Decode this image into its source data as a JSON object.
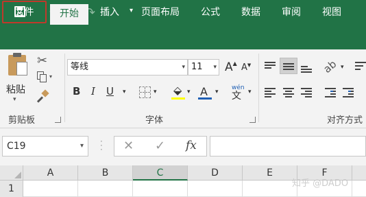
{
  "qat": {
    "customize_glyph": "▾",
    "undo_glyph": "↶",
    "redo_glyph": "↷",
    "dd_glyph": "▾"
  },
  "tabs": {
    "file": "文件",
    "home": "开始",
    "insert": "插入",
    "page_layout": "页面布局",
    "formulas": "公式",
    "data": "数据",
    "review": "审阅",
    "view": "视图"
  },
  "ribbon": {
    "paste_label": "粘贴",
    "clipboard_group": "剪贴板",
    "font_group": "字体",
    "alignment_group": "对齐方式",
    "font_name": "等线",
    "font_size": "11",
    "grow_font": "A",
    "shrink_font": "A",
    "bold": "B",
    "italic": "I",
    "underline": "U",
    "font_color": "A",
    "phonetic_top": "wén",
    "phonetic_bottom": "文",
    "font_color_bar": "#c00000",
    "highlight_bar": "#ffff00",
    "font_color_underline": "#1f5fb4"
  },
  "formula_bar": {
    "name_box": "C19",
    "cancel": "✕",
    "enter": "✓",
    "fx": "fx"
  },
  "grid": {
    "columns": [
      "A",
      "B",
      "C",
      "D",
      "E",
      "F"
    ],
    "selected_column": "C",
    "rows": [
      "1"
    ]
  },
  "watermark": "知乎 @DADO",
  "colors": {
    "accent": "#217346",
    "highlight_border": "#c0392b"
  }
}
